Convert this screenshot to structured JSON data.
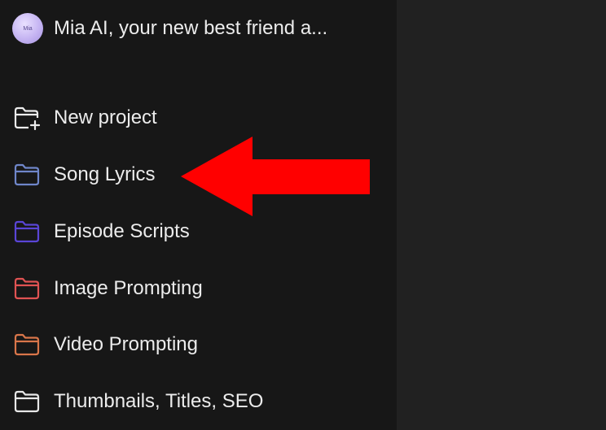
{
  "gpt": {
    "avatar_text": "Mia",
    "title": "Mia AI, your new best friend a..."
  },
  "new_project": {
    "label": "New project",
    "icon": "folder-plus-icon"
  },
  "projects": [
    {
      "label": "Song Lyrics",
      "color": "#6f86c9"
    },
    {
      "label": "Episode Scripts",
      "color": "#5a45d6"
    },
    {
      "label": "Image Prompting",
      "color": "#e05353"
    },
    {
      "label": "Video Prompting",
      "color": "#d9764a"
    },
    {
      "label": "Thumbnails, Titles, SEO",
      "color": "#e8e8e8"
    }
  ],
  "annotation": {
    "arrow_color": "#ff0000",
    "arrow_target": "Song Lyrics"
  }
}
